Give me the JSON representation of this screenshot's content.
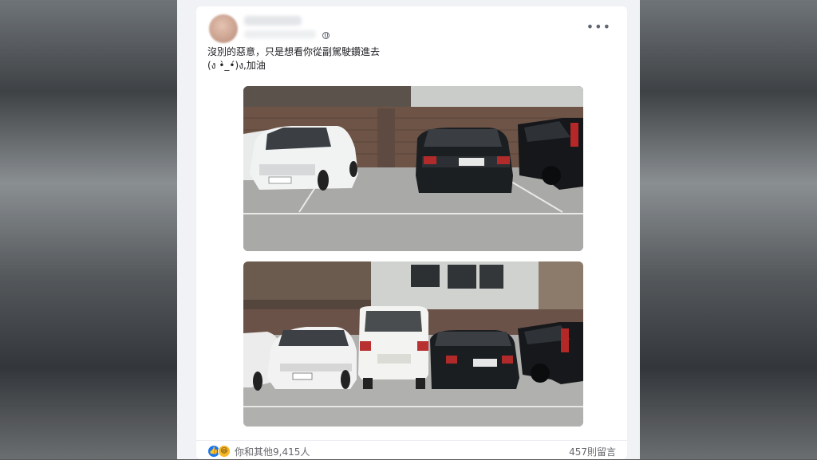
{
  "post": {
    "text_line1": "沒別的惡意，只是想看你從副駕駛鑽進去",
    "text_line2": "(ง •̀_•́)ง,加油",
    "more_label": "•••"
  },
  "photos": [
    {
      "description_icon": "parking-lot-photo-1"
    },
    {
      "description_icon": "parking-lot-photo-2"
    }
  ],
  "footer": {
    "reaction_count": "你和其他9,415人",
    "comment_count": "457則留言",
    "like_glyph": "👍",
    "haha_glyph": "😆"
  },
  "colors": {
    "like_blue": "#1877f2",
    "haha_yellow": "#f7b928"
  }
}
